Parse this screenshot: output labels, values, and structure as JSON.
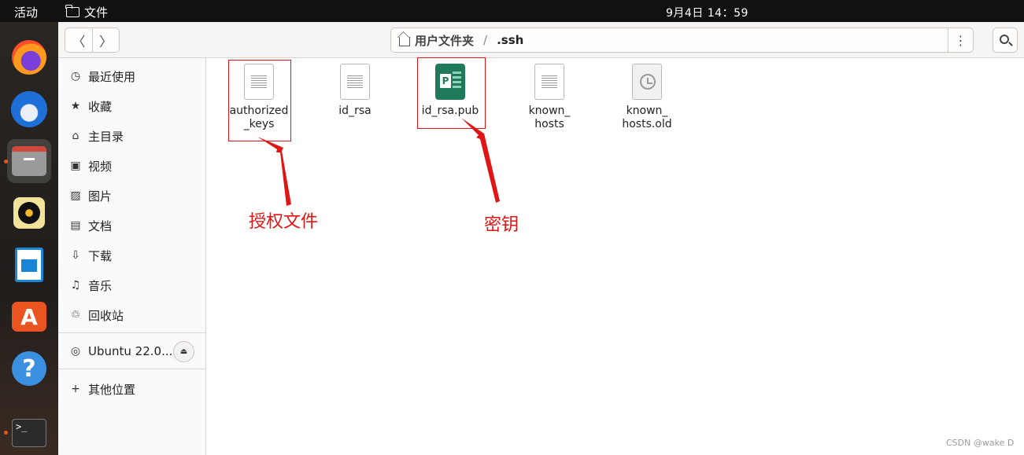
{
  "topbar": {
    "activities": "活动",
    "app_menu": "文件",
    "clock": "9月4日  14：59"
  },
  "dock": {
    "items": [
      {
        "icon": "firefox-icon"
      },
      {
        "icon": "thunderbird-icon"
      },
      {
        "icon": "files-icon",
        "active": true
      },
      {
        "icon": "rhythmbox-icon"
      },
      {
        "icon": "libreoffice-writer-icon"
      },
      {
        "icon": "app-center-icon",
        "glyph": "A"
      },
      {
        "icon": "help-icon",
        "glyph": "?"
      },
      {
        "icon": "terminal-icon",
        "glyph": ">_"
      }
    ]
  },
  "header": {
    "back_glyph": "〈",
    "forward_glyph": "〉",
    "path_home": "用户文件夹",
    "path_separator": "/",
    "path_current": ".ssh",
    "menu_glyph": "⋮"
  },
  "sidebar": {
    "items": [
      {
        "icon": "clock-icon",
        "glyph": "◷",
        "label": "最近使用"
      },
      {
        "icon": "star-icon",
        "glyph": "★",
        "label": "收藏"
      },
      {
        "icon": "home-icon",
        "glyph": "⌂",
        "label": "主目录"
      },
      {
        "icon": "video-icon",
        "glyph": "▣",
        "label": "视频"
      },
      {
        "icon": "picture-icon",
        "glyph": "▨",
        "label": "图片"
      },
      {
        "icon": "document-icon",
        "glyph": "▤",
        "label": "文档"
      },
      {
        "icon": "download-icon",
        "glyph": "⇩",
        "label": "下载"
      },
      {
        "icon": "music-icon",
        "glyph": "♫",
        "label": "音乐"
      },
      {
        "icon": "trash-icon",
        "glyph": "♲",
        "label": "回收站"
      }
    ],
    "device": {
      "icon": "disc-icon",
      "glyph": "◎",
      "label": "Ubuntu 22.0...",
      "eject_glyph": "⏏"
    },
    "other": {
      "glyph": "+",
      "label": "其他位置"
    }
  },
  "files": [
    {
      "name": "authorized\n_keys",
      "type": "text"
    },
    {
      "name": "id_rsa",
      "type": "text"
    },
    {
      "name": "id_rsa.pub",
      "type": "publisher"
    },
    {
      "name": "known_\nhosts",
      "type": "text"
    },
    {
      "name": "known_\nhosts.old",
      "type": "backup"
    }
  ],
  "annotations": {
    "authorized_keys_label": "授权文件",
    "id_rsa_pub_label": "密钥",
    "color": "#e01515"
  },
  "watermark": "CSDN @wake D"
}
